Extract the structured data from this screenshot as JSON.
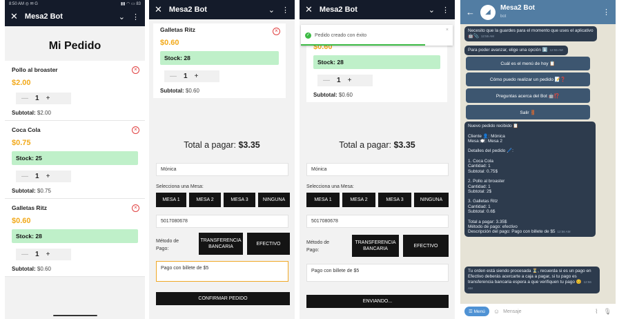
{
  "status": {
    "left": "8:50 AM ◎ ✉ G",
    "right": "▮▮ ◠ ▭ 83"
  },
  "header": {
    "title": "Mesa2 Bot"
  },
  "p1": {
    "title": "Mi Pedido",
    "items": [
      {
        "name": "Pollo al broaster",
        "price": "$2.00",
        "stock": "",
        "qty": "1",
        "subtotal_label": "Subtotal:",
        "subtotal": "$2.00"
      },
      {
        "name": "Coca Cola",
        "price": "$0.75",
        "stock": "Stock: 25",
        "qty": "1",
        "subtotal_label": "Subtotal:",
        "subtotal": "$0.75"
      },
      {
        "name": "Galletas Ritz",
        "price": "$0.60",
        "stock": "Stock: 28",
        "qty": "1",
        "subtotal_label": "Subtotal:",
        "subtotal": "$0.60"
      }
    ]
  },
  "p2": {
    "item": {
      "name": "Galletas Ritz",
      "price": "$0.60",
      "stock": "Stock: 28",
      "qty": "1",
      "subtotal_label": "Subtotal:",
      "subtotal": "$0.60"
    },
    "total_label": "Total a pagar:",
    "total": "$3.35",
    "name_value": "Mónica",
    "mesa_label": "Selecciona una Mesa:",
    "mesas": [
      "MESA 1",
      "MESA 2",
      "MESA 3",
      "NINGUNA"
    ],
    "phone": "5017080678",
    "metodo_label": "Método de\nPago:",
    "transfer": "TRANSFERENCIA\nBANCARIA",
    "efectivo": "EFECTIVO",
    "nota": "Pago con billete de $5",
    "confirm": "CONFIRMAR PEDIDO"
  },
  "p3": {
    "toast": "Pedido creado con éxito",
    "item": {
      "price": "$0.60",
      "stock": "Stock: 28",
      "qty": "1",
      "subtotal_label": "Subtotal:",
      "subtotal": "$0.60"
    },
    "total_label": "Total a pagar:",
    "total": "$3.35",
    "name_value": "Mónica",
    "mesa_label": "Selecciona una Mesa:",
    "mesas": [
      "MESA 1",
      "MESA 2",
      "MESA 3",
      "NINGUNA"
    ],
    "phone": "5017080678",
    "metodo_label": "Método de\nPago:",
    "transfer": "TRANSFERENCIA\nBANCARIA",
    "efectivo": "EFECTIVO",
    "nota": "Pago con billete de $5",
    "sending": "ENVIANDO..."
  },
  "tg": {
    "title": "Mesa2 Bot",
    "subtitle": "bot",
    "msg1": "Necesito que la guardes para el momento que uses el aplicativo 🤖📎",
    "msg1_time": "12:55 AM",
    "msg2": "Para poder avanzar, elige una opción ⬇️",
    "msg2_time": "12:55 AM",
    "kb": [
      "Cuál es el menú de hoy 📋",
      "Cómo puedo realizar un pedido 📝❓",
      "Preguntas acerca del Bot 🤖⁉️",
      "Salir 🚪"
    ],
    "msg3": "Nuevo pedido recibido 📋\n\nCliente 👤: Mónica\nMesa 🍽️: Mesa 2\n\nDetalles del pedido 🖊️:\n\n1. Coca Cola\nCantidad: 1\nSubtotal: 0.75$\n\n2. Pollo al broaster\nCantidad: 1\nSubtotal: 2$\n\n3. Galletas Ritz\nCantidad: 1\nSubtotal: 0.6$\n\nTotal a pagar: 3.35$\nMétodo de pago: efectivo\nDescripción del pago: Pago con billete de $5",
    "msg3_time": "12:56 AM",
    "msg4": "Tu orden está siendo procesada ⏳, recuerda si es un pago en Efectivo deberás acercarte a caja a pagar, si tu pago es transferencia bancaria espera a que verifiquen tu pago 😊",
    "msg4_time": "12:56 AM",
    "menu": "☰ Menú",
    "placeholder": "Mensaje"
  }
}
